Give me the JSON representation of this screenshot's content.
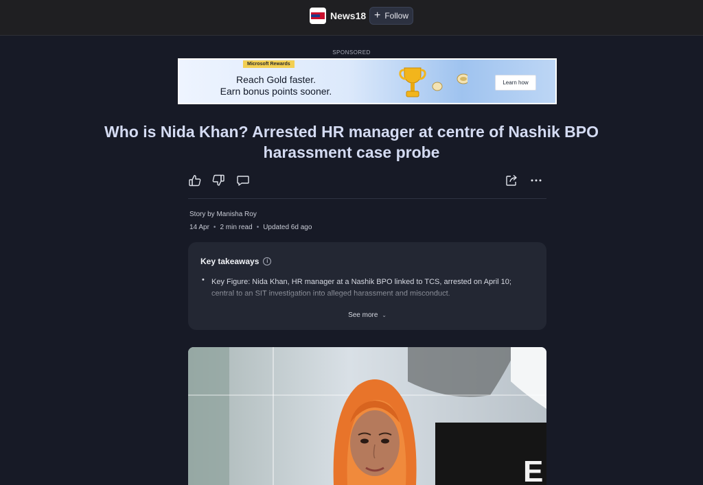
{
  "header": {
    "publisher_name": "News18",
    "logo_icon": "news18-logo-icon",
    "follow_label": "Follow"
  },
  "ad": {
    "sponsored_label": "SPONSORED",
    "badge": "Microsoft Rewards",
    "headline_line1": "Reach Gold faster.",
    "headline_line2": "Earn bonus points sooner.",
    "cta": "Learn how"
  },
  "article": {
    "title_line1": "Who is Nida Khan? Arrested HR manager at centre of Nashik BPO",
    "title_line2": "harassment case probe",
    "byline": "Story by Manisha Roy",
    "date": "14 Apr",
    "read_time": "2 min read",
    "updated": "Updated 6d ago",
    "actions": [
      "thumbs-up-icon",
      "thumbs-down-icon",
      "comment-icon",
      "share-icon",
      "more-options-icon"
    ]
  },
  "takeaways": {
    "title": "Key takeaways",
    "info_icon": "i",
    "items": [
      "Key Figure: Nida Khan, HR manager at a Nashik BPO linked to TCS, arrested on April 10; central to an SIT investigation into alleged harassment and misconduct."
    ],
    "see_more": "See more"
  },
  "photo": {
    "backdrop_letters": "E"
  },
  "colors": {
    "page_bg": "#171a26",
    "topbar_bg": "#1f1f22",
    "card_bg": "#232733",
    "title_color": "#d4dbf2",
    "ad_badge": "#f3cf52"
  }
}
